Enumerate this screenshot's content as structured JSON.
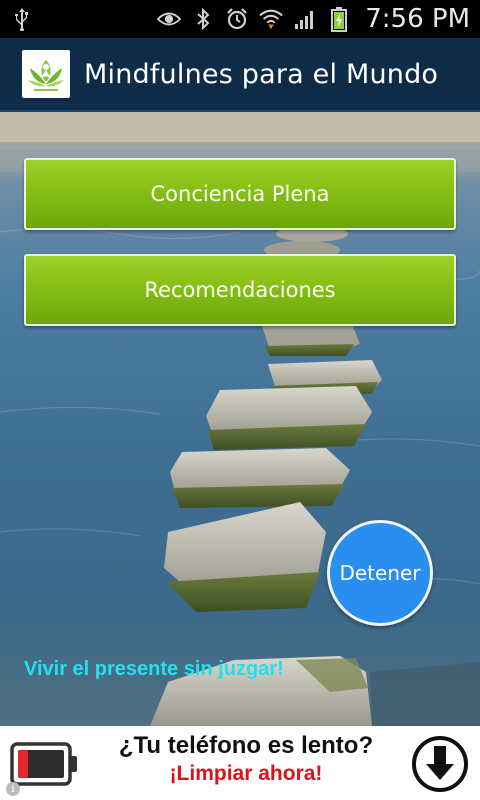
{
  "status_bar": {
    "time": "7:56 PM",
    "icons": [
      "usb-icon",
      "eye-icon",
      "bluetooth-icon",
      "alarm-icon",
      "wifi-icon",
      "signal-icon",
      "battery-icon"
    ]
  },
  "app": {
    "title": "Mindfulnes para el Mundo",
    "logo": "lotus-logo-icon"
  },
  "menu": {
    "items": [
      {
        "label": "Conciencia Plena"
      },
      {
        "label": "Recomendaciones"
      }
    ]
  },
  "stop_button": {
    "label": "Detener"
  },
  "tagline": "Vivir el presente sin juzgar!",
  "ad": {
    "line1": "¿Tu teléfono es lento?",
    "line2": "¡Limpiar ahora!",
    "info_label": "i",
    "icons": [
      "battery-low-icon",
      "download-icon",
      "info-icon"
    ]
  },
  "colors": {
    "action_bar": "#0e2c47",
    "button_green": "#86bf14",
    "stop_blue": "#2a8ef0",
    "tagline_cyan": "#22e1ee",
    "ad_red": "#d8141a"
  }
}
